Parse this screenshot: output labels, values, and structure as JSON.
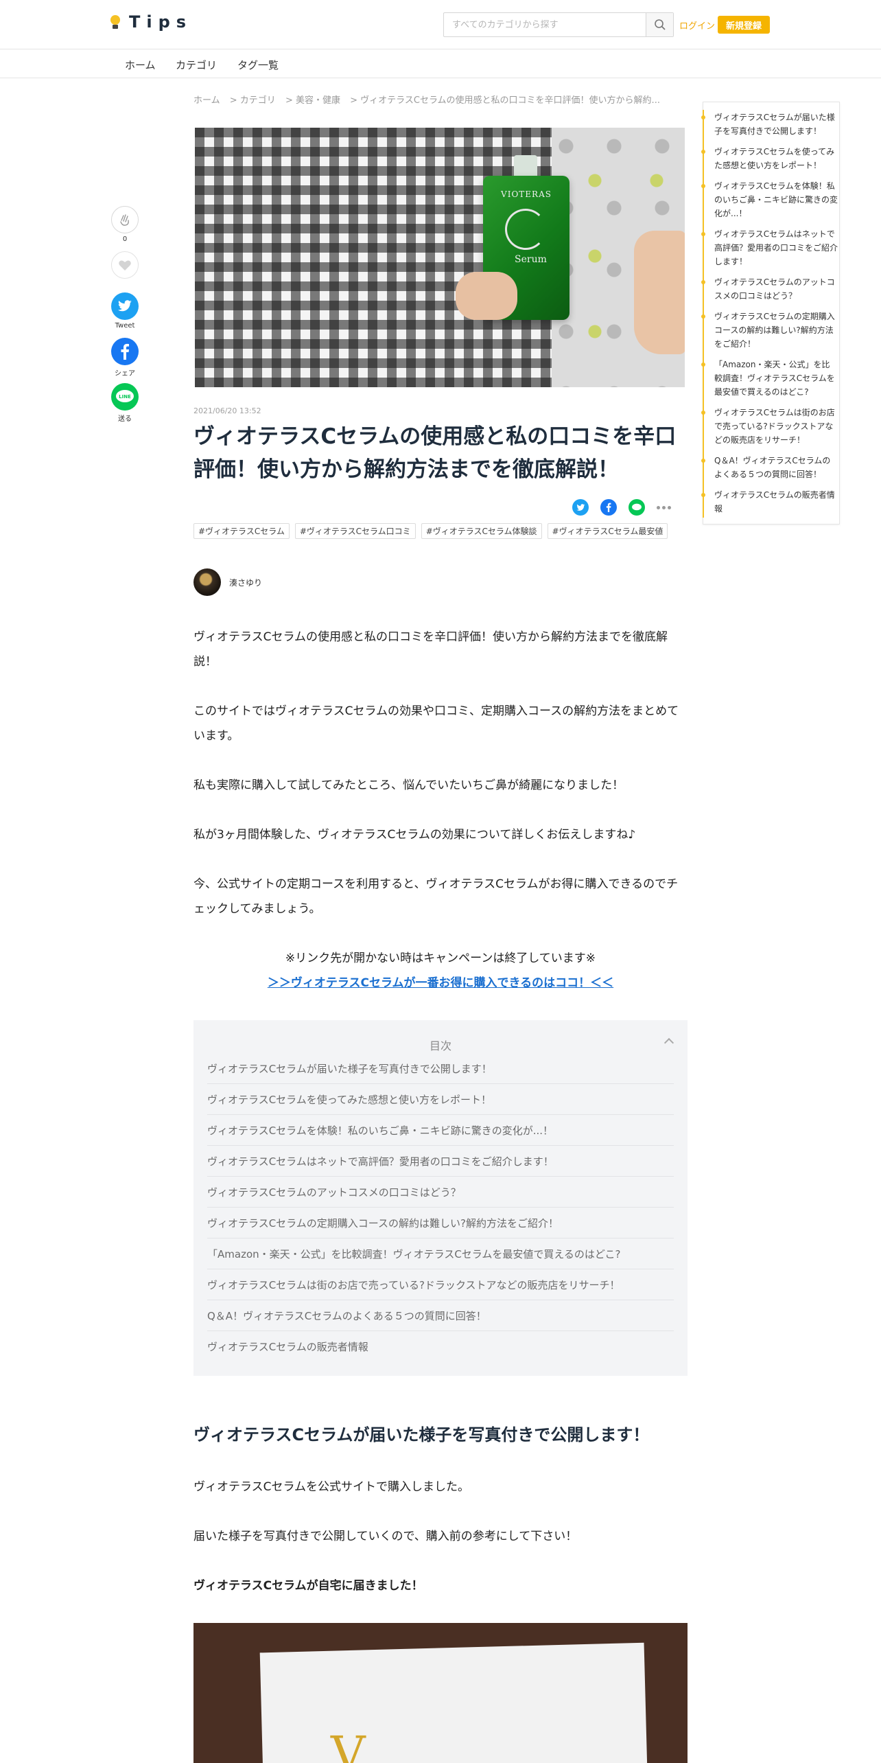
{
  "header": {
    "logo_text": "Tips",
    "search_placeholder": "すべてのカテゴリから探す",
    "login_label": "ログイン",
    "signup_label": "新規登録"
  },
  "subnav": {
    "items": [
      "ホーム",
      "カテゴリ",
      "タグ一覧"
    ]
  },
  "breadcrumb": [
    "ホーム",
    "> カテゴリ",
    "> 美容・健康",
    "> ヴィオテラスCセラムの使用感と私の口コミを辛口評価！使い方から解約..."
  ],
  "hero": {
    "bottle_label": "VIOTERAS",
    "bottle_serum": "Serum"
  },
  "share_sidebar": {
    "clap_count": "0",
    "twitter_label": "Tweet",
    "facebook_label": "シェア",
    "line_label": "送る",
    "line_icon_text": "LINE"
  },
  "article": {
    "timestamp": "2021/06/20 13:52",
    "title": "ヴィオテラスCセラムの使用感と私の口コミを辛口評価！使い方から解約方法までを徹底解説！",
    "tags": [
      "#ヴィオテラスCセラム",
      "#ヴィオテラスCセラム口コミ",
      "#ヴィオテラスCセラム体験談",
      "#ヴィオテラスCセラム最安値"
    ],
    "author": "湊さゆり",
    "paragraphs": [
      "ヴィオテラスCセラムの使用感と私の口コミを辛口評価！使い方から解約方法までを徹底解説！",
      "このサイトではヴィオテラスCセラムの効果や口コミ、定期購入コースの解約方法をまとめています。",
      "私も実際に購入して試してみたところ、悩んでいたいちご鼻が綺麗になりました！",
      "私が3ヶ月間体験した、ヴィオテラスCセラムの効果について詳しくお伝えしますね♪",
      "今、公式サイトの定期コースを利用すると、ヴィオテラスCセラムがお得に購入できるのでチェックしてみましょう。"
    ],
    "campaign_note": "※リンク先が開かない時はキャンペーンは終了しています※",
    "campaign_link": "＞＞ヴィオテラスCセラムが一番お得に購入できるのはココ！＜＜"
  },
  "toc": {
    "title": "目次",
    "items": [
      "ヴィオテラスCセラムが届いた様子を写真付きで公開します！",
      "ヴィオテラスCセラムを使ってみた感想と使い方をレポート！",
      "ヴィオテラスCセラムを体験！私のいちご鼻・ニキビ跡に驚きの変化が...！",
      "ヴィオテラスCセラムはネットで高評価？愛用者の口コミをご紹介します！",
      "ヴィオテラスCセラムのアットコスメの口コミはどう？",
      "ヴィオテラスCセラムの定期購入コースの解約は難しい?解約方法をご紹介！",
      "「Amazon・楽天・公式」を比較調査！ヴィオテラスCセラムを最安値で買えるのはどこ?",
      "ヴィオテラスCセラムは街のお店で売っている?ドラックストアなどの販売店をリサーチ！",
      "Q＆A！ヴィオテラスCセラムのよくある５つの質問に回答！",
      "ヴィオテラスCセラムの販売者情報"
    ]
  },
  "section1": {
    "heading": "ヴィオテラスCセラムが届いた様子を写真付きで公開します！",
    "p1": "ヴィオテラスCセラムを公式サイトで購入しました。",
    "p2": "届いた様子を写真付きで公開していくので、購入前の参考にして下さい！",
    "p3": "ヴィオテラスCセラムが自宅に届きました！",
    "photo_letter": "V"
  },
  "side_toc": {
    "items": [
      "ヴィオテラスCセラムが届いた様子を写真付きで公開します！",
      "ヴィオテラスCセラムを使ってみた感想と使い方をレポート！",
      "ヴィオテラスCセラムを体験！私のいちご鼻・ニキビ跡に驚きの変化が...！",
      "ヴィオテラスCセラムはネットで高評価？愛用者の口コミをご紹介します！",
      "ヴィオテラスCセラムのアットコスメの口コミはどう？",
      "ヴィオテラスCセラムの定期購入コースの解約は難しい?解約方法をご紹介！",
      "「Amazon・楽天・公式」を比較調査！ヴィオテラスCセラムを最安値で買えるのはどこ?",
      "ヴィオテラスCセラムは街のお店で売っている?ドラックストアなどの販売店をリサーチ！",
      "Q＆A！ヴィオテラスCセラムのよくある５つの質問に回答！",
      "ヴィオテラスCセラムの販売者情報"
    ]
  },
  "colors": {
    "brand_yellow": "#f5b400",
    "link_blue": "#1a6fd0",
    "twitter": "#1da1f2",
    "facebook": "#1877f2",
    "line": "#06c755"
  }
}
